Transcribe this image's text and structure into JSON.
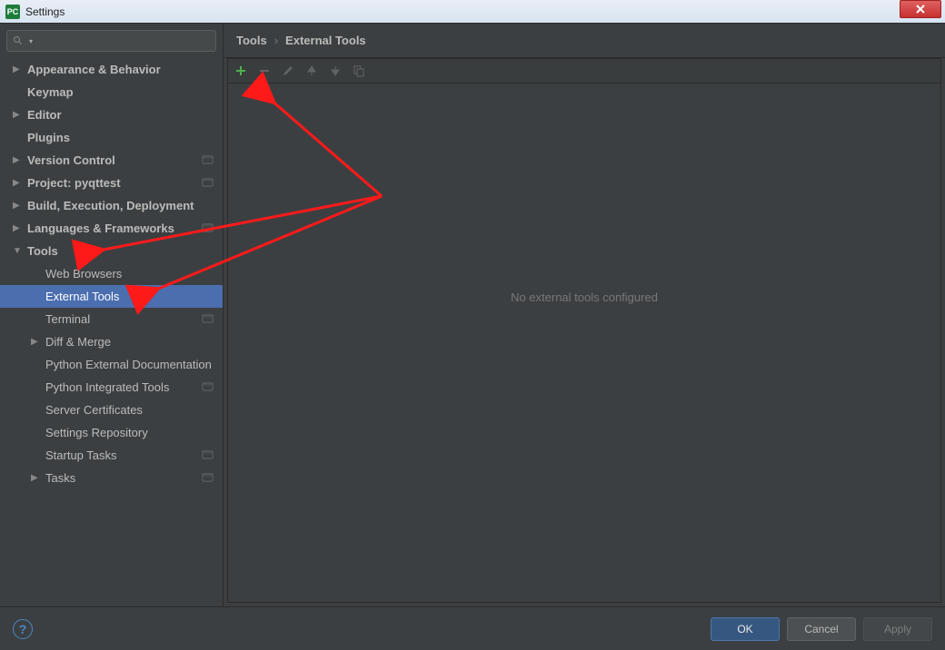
{
  "window": {
    "title": "Settings",
    "app_icon_text": "PC"
  },
  "search": {
    "placeholder": ""
  },
  "breadcrumb": {
    "root": "Tools",
    "leaf": "External Tools"
  },
  "sidebar": {
    "items": [
      {
        "label": "Appearance & Behavior",
        "arrow": "right",
        "level": 0
      },
      {
        "label": "Keymap",
        "arrow": "none",
        "level": 0
      },
      {
        "label": "Editor",
        "arrow": "right",
        "level": 0
      },
      {
        "label": "Plugins",
        "arrow": "none",
        "level": 0
      },
      {
        "label": "Version Control",
        "arrow": "right",
        "level": 0,
        "proj": true
      },
      {
        "label": "Project: pyqttest",
        "arrow": "right",
        "level": 0,
        "proj": true
      },
      {
        "label": "Build, Execution, Deployment",
        "arrow": "right",
        "level": 0
      },
      {
        "label": "Languages & Frameworks",
        "arrow": "right",
        "level": 0,
        "proj": true
      },
      {
        "label": "Tools",
        "arrow": "down",
        "level": 0
      },
      {
        "label": "Web Browsers",
        "arrow": "none",
        "level": 1,
        "sub": true
      },
      {
        "label": "External Tools",
        "arrow": "none",
        "level": 1,
        "sub": true,
        "selected": true
      },
      {
        "label": "Terminal",
        "arrow": "none",
        "level": 1,
        "sub": true,
        "proj": true
      },
      {
        "label": "Diff & Merge",
        "arrow": "right",
        "level": 1,
        "sub": true
      },
      {
        "label": "Python External Documentation",
        "arrow": "none",
        "level": 1,
        "sub": true
      },
      {
        "label": "Python Integrated Tools",
        "arrow": "none",
        "level": 1,
        "sub": true,
        "proj": true
      },
      {
        "label": "Server Certificates",
        "arrow": "none",
        "level": 1,
        "sub": true
      },
      {
        "label": "Settings Repository",
        "arrow": "none",
        "level": 1,
        "sub": true
      },
      {
        "label": "Startup Tasks",
        "arrow": "none",
        "level": 1,
        "sub": true,
        "proj": true
      },
      {
        "label": "Tasks",
        "arrow": "right",
        "level": 1,
        "sub": true,
        "proj": true
      }
    ]
  },
  "toolbar": {
    "buttons": [
      {
        "name": "add",
        "enabled": true
      },
      {
        "name": "remove",
        "enabled": false
      },
      {
        "name": "edit",
        "enabled": false
      },
      {
        "name": "up",
        "enabled": false
      },
      {
        "name": "down",
        "enabled": false
      },
      {
        "name": "copy",
        "enabled": false
      }
    ]
  },
  "main": {
    "placeholder": "No external tools configured"
  },
  "footer": {
    "ok": "OK",
    "cancel": "Cancel",
    "apply": "Apply"
  }
}
